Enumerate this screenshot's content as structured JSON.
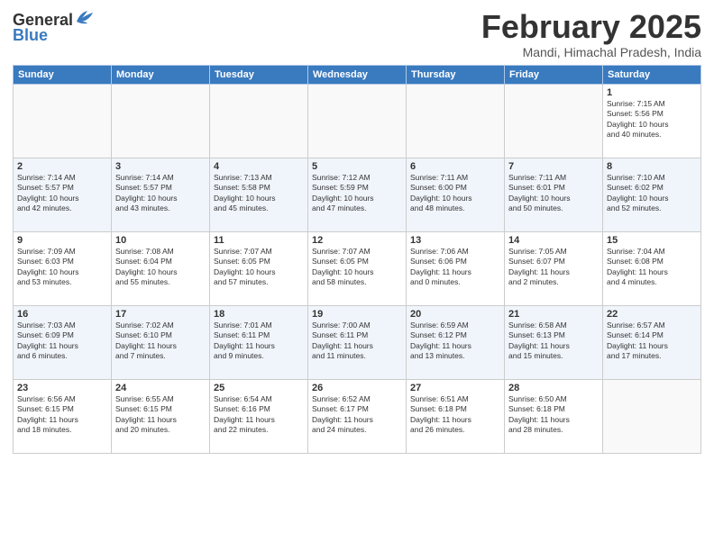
{
  "logo": {
    "general": "General",
    "blue": "Blue"
  },
  "header": {
    "title": "February 2025",
    "subtitle": "Mandi, Himachal Pradesh, India"
  },
  "days_of_week": [
    "Sunday",
    "Monday",
    "Tuesday",
    "Wednesday",
    "Thursday",
    "Friday",
    "Saturday"
  ],
  "weeks": [
    [
      {
        "day": "",
        "info": ""
      },
      {
        "day": "",
        "info": ""
      },
      {
        "day": "",
        "info": ""
      },
      {
        "day": "",
        "info": ""
      },
      {
        "day": "",
        "info": ""
      },
      {
        "day": "",
        "info": ""
      },
      {
        "day": "1",
        "info": "Sunrise: 7:15 AM\nSunset: 5:56 PM\nDaylight: 10 hours\nand 40 minutes."
      }
    ],
    [
      {
        "day": "2",
        "info": "Sunrise: 7:14 AM\nSunset: 5:57 PM\nDaylight: 10 hours\nand 42 minutes."
      },
      {
        "day": "3",
        "info": "Sunrise: 7:14 AM\nSunset: 5:57 PM\nDaylight: 10 hours\nand 43 minutes."
      },
      {
        "day": "4",
        "info": "Sunrise: 7:13 AM\nSunset: 5:58 PM\nDaylight: 10 hours\nand 45 minutes."
      },
      {
        "day": "5",
        "info": "Sunrise: 7:12 AM\nSunset: 5:59 PM\nDaylight: 10 hours\nand 47 minutes."
      },
      {
        "day": "6",
        "info": "Sunrise: 7:11 AM\nSunset: 6:00 PM\nDaylight: 10 hours\nand 48 minutes."
      },
      {
        "day": "7",
        "info": "Sunrise: 7:11 AM\nSunset: 6:01 PM\nDaylight: 10 hours\nand 50 minutes."
      },
      {
        "day": "8",
        "info": "Sunrise: 7:10 AM\nSunset: 6:02 PM\nDaylight: 10 hours\nand 52 minutes."
      }
    ],
    [
      {
        "day": "9",
        "info": "Sunrise: 7:09 AM\nSunset: 6:03 PM\nDaylight: 10 hours\nand 53 minutes."
      },
      {
        "day": "10",
        "info": "Sunrise: 7:08 AM\nSunset: 6:04 PM\nDaylight: 10 hours\nand 55 minutes."
      },
      {
        "day": "11",
        "info": "Sunrise: 7:07 AM\nSunset: 6:05 PM\nDaylight: 10 hours\nand 57 minutes."
      },
      {
        "day": "12",
        "info": "Sunrise: 7:07 AM\nSunset: 6:05 PM\nDaylight: 10 hours\nand 58 minutes."
      },
      {
        "day": "13",
        "info": "Sunrise: 7:06 AM\nSunset: 6:06 PM\nDaylight: 11 hours\nand 0 minutes."
      },
      {
        "day": "14",
        "info": "Sunrise: 7:05 AM\nSunset: 6:07 PM\nDaylight: 11 hours\nand 2 minutes."
      },
      {
        "day": "15",
        "info": "Sunrise: 7:04 AM\nSunset: 6:08 PM\nDaylight: 11 hours\nand 4 minutes."
      }
    ],
    [
      {
        "day": "16",
        "info": "Sunrise: 7:03 AM\nSunset: 6:09 PM\nDaylight: 11 hours\nand 6 minutes."
      },
      {
        "day": "17",
        "info": "Sunrise: 7:02 AM\nSunset: 6:10 PM\nDaylight: 11 hours\nand 7 minutes."
      },
      {
        "day": "18",
        "info": "Sunrise: 7:01 AM\nSunset: 6:11 PM\nDaylight: 11 hours\nand 9 minutes."
      },
      {
        "day": "19",
        "info": "Sunrise: 7:00 AM\nSunset: 6:11 PM\nDaylight: 11 hours\nand 11 minutes."
      },
      {
        "day": "20",
        "info": "Sunrise: 6:59 AM\nSunset: 6:12 PM\nDaylight: 11 hours\nand 13 minutes."
      },
      {
        "day": "21",
        "info": "Sunrise: 6:58 AM\nSunset: 6:13 PM\nDaylight: 11 hours\nand 15 minutes."
      },
      {
        "day": "22",
        "info": "Sunrise: 6:57 AM\nSunset: 6:14 PM\nDaylight: 11 hours\nand 17 minutes."
      }
    ],
    [
      {
        "day": "23",
        "info": "Sunrise: 6:56 AM\nSunset: 6:15 PM\nDaylight: 11 hours\nand 18 minutes."
      },
      {
        "day": "24",
        "info": "Sunrise: 6:55 AM\nSunset: 6:15 PM\nDaylight: 11 hours\nand 20 minutes."
      },
      {
        "day": "25",
        "info": "Sunrise: 6:54 AM\nSunset: 6:16 PM\nDaylight: 11 hours\nand 22 minutes."
      },
      {
        "day": "26",
        "info": "Sunrise: 6:52 AM\nSunset: 6:17 PM\nDaylight: 11 hours\nand 24 minutes."
      },
      {
        "day": "27",
        "info": "Sunrise: 6:51 AM\nSunset: 6:18 PM\nDaylight: 11 hours\nand 26 minutes."
      },
      {
        "day": "28",
        "info": "Sunrise: 6:50 AM\nSunset: 6:18 PM\nDaylight: 11 hours\nand 28 minutes."
      },
      {
        "day": "",
        "info": ""
      }
    ]
  ]
}
